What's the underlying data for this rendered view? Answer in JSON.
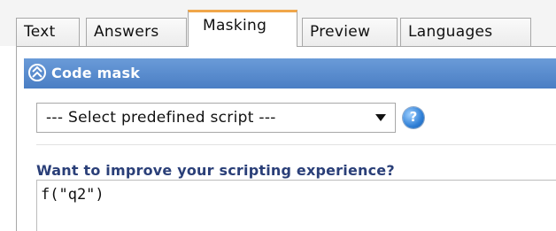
{
  "tabs": [
    {
      "label": "Text",
      "active": false
    },
    {
      "label": "Answers",
      "active": false
    },
    {
      "label": "Masking",
      "active": true
    },
    {
      "label": "Preview",
      "active": false
    },
    {
      "label": "Languages",
      "active": false
    }
  ],
  "section": {
    "title": "Code mask",
    "collapse_icon": "double-chevron-up-icon"
  },
  "script_select": {
    "selected": "--- Select predefined script ---"
  },
  "help": {
    "icon": "help-icon",
    "glyph": "?"
  },
  "improve_label": "Want to improve your scripting experience?",
  "code_editor": {
    "value": "f(\"q2\")"
  },
  "colors": {
    "active_tab_accent": "#f0a64a",
    "header_blue": "#5a8ccf",
    "label_navy": "#2a3f78"
  }
}
